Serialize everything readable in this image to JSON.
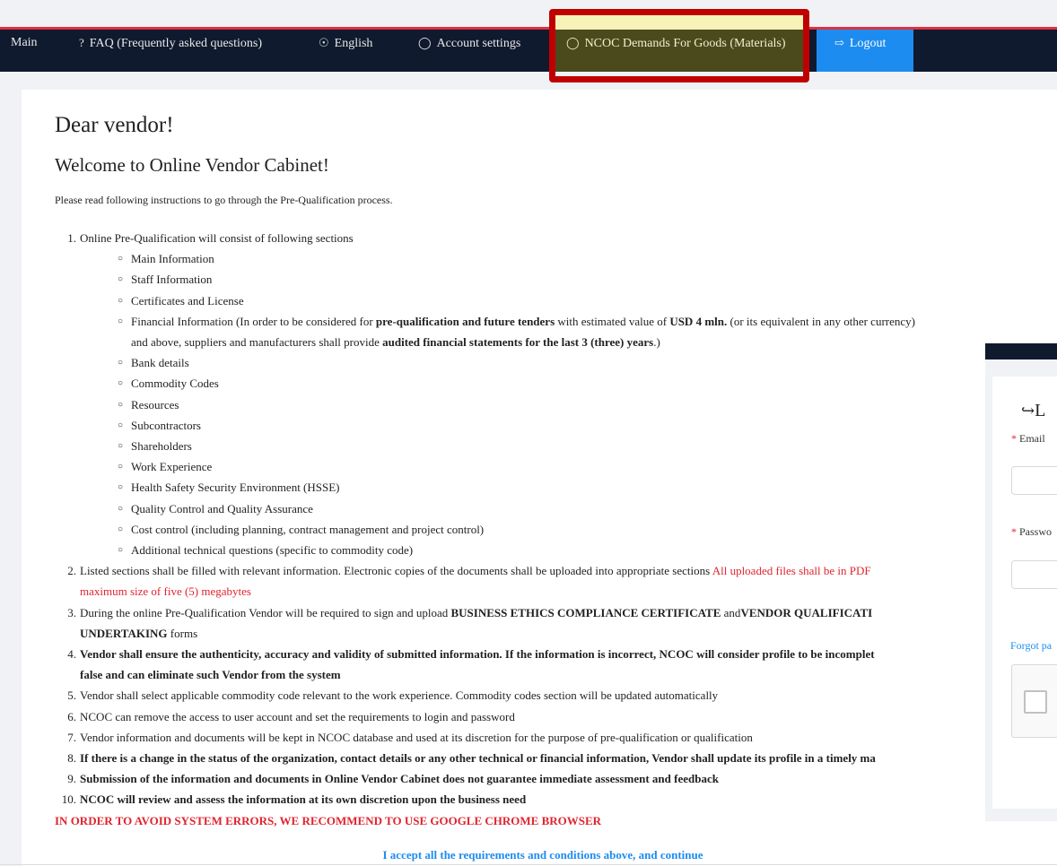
{
  "nav": {
    "main": "Main",
    "faq": "FAQ (Frequently asked questions)",
    "language": "English",
    "account": "Account settings",
    "demands": "NCOC Demands For Goods (Materials)",
    "logout": "Logout"
  },
  "content": {
    "greeting": "Dear vendor!",
    "welcome": "Welcome to Online Vendor Cabinet!",
    "intro": "Please read following instructions to go through the Pre-Qualification process.",
    "item1": "Online Pre-Qualification will consist of following sections",
    "sections": [
      "Main Information",
      "Staff Information",
      "Certificates and License"
    ],
    "fin_a": "Financial Information (In order to be considered for ",
    "fin_b": "pre-qualification and future tenders",
    "fin_c": " with estimated value of ",
    "fin_d": "USD 4 mln.",
    "fin_e": " (or its equivalent in any other currency)",
    "fin_f": "and above, suppliers and manufacturers shall provide ",
    "fin_g": "audited financial statements for the last 3 (three) years",
    "fin_h": ".)",
    "sections2": [
      "Bank details",
      "Commodity Codes",
      "Resources",
      "Subcontractors",
      "Shareholders",
      "Work Experience",
      "Health Safety Security Environment (HSSE)",
      "Quality Control and Quality Assurance",
      "Cost control (including planning, contract management and project control)",
      "Additional technical questions (specific to commodity code)"
    ],
    "item2a": "Listed sections shall be filled with relevant information. Electronic copies of the documents shall be uploaded into appropriate sections ",
    "item2b": "All uploaded files shall be in PDF",
    "item2c": "maximum size of five (5) megabytes",
    "item3a": "During the online Pre-Qualification Vendor will be required to sign and upload  ",
    "item3b": "BUSINESS ETHICS COMPLIANCE CERTIFICATE",
    "item3c": " and",
    "item3d": "VENDOR QUALIFICATI",
    "item3e": "UNDERTAKING",
    "item3f": " forms",
    "item4a": "Vendor shall ensure the authenticity, accuracy and validity of submitted information. If the information is incorrect, NCOC will consider profile to be incomplet",
    "item4b": "false and can eliminate such Vendor from the system",
    "item5": "Vendor shall select applicable commodity code relevant to the work experience. Commodity codes section will be updated automatically",
    "item6": "NCOC can remove the access to user account and set the requirements to login and password",
    "item7": "Vendor information and documents will be kept in NCOC database and used at its discretion for the purpose of pre-qualification or qualification",
    "item8": "If there is a change in the status of the organization, contact details or any other technical or financial information, Vendor shall update its profile in a timely ma",
    "item9": "Submission of the information and documents in Online Vendor Cabinet does not guarantee immediate assessment and feedback",
    "item10": "NCOC will review and assess the information at its own discretion upon the business need",
    "warning": "IN ORDER TO AVOID SYSTEM ERRORS, WE RECOMMEND TO USE GOOGLE CHROME BROWSER",
    "accept": "I accept all the requirements and conditions above, and continue"
  },
  "login": {
    "title": "L",
    "email_label": "Email",
    "password_label": "Passwo",
    "forgot": "Forgot pa"
  }
}
